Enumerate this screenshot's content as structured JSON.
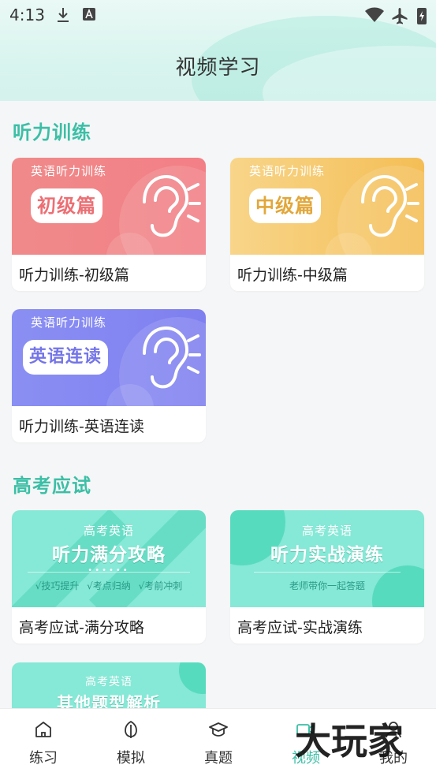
{
  "status_bar": {
    "time": "4:13"
  },
  "header": {
    "title": "视频学习"
  },
  "sections": [
    {
      "title": "听力训练",
      "cards": [
        {
          "tag": "英语听力训练",
          "badge": "初级篇",
          "caption": "听力训练-初级篇",
          "theme": "#f08285"
        },
        {
          "tag": "英语听力训练",
          "badge": "中级篇",
          "caption": "听力训练-中级篇",
          "theme": "#f5c463"
        },
        {
          "tag": "英语听力训练",
          "badge": "英语连读",
          "caption": "听力训练-英语连读",
          "theme": "#8487f2"
        }
      ]
    },
    {
      "title": "高考应试",
      "cards": [
        {
          "sub": "高考英语",
          "main": "听力满分攻略",
          "tags": "√技巧提升 √考点归纳 √考前冲刺",
          "caption": "高考应试-满分攻略"
        },
        {
          "sub": "高考英语",
          "main": "听力实战演练",
          "note": "老师带你一起答题",
          "caption": "高考应试-实战演练"
        },
        {
          "sub": "高考英语",
          "main": "其他题型解析"
        }
      ]
    }
  ],
  "nav": {
    "items": [
      {
        "label": "练习",
        "icon": "home-icon"
      },
      {
        "label": "模拟",
        "icon": "leaf-icon"
      },
      {
        "label": "真题",
        "icon": "graduation-cap-icon"
      },
      {
        "label": "视频",
        "icon": "video-camera-icon",
        "active": true
      },
      {
        "label": "我的",
        "icon": "person-icon"
      }
    ]
  },
  "watermark": {
    "text": "大玩家"
  },
  "colors": {
    "accent": "#3bbfa6",
    "header_bg": "#dcf5ef",
    "red_card": "#f08285",
    "yellow_card": "#f5c463",
    "blue_card": "#8487f2",
    "teal_card": "#86e8d6"
  }
}
